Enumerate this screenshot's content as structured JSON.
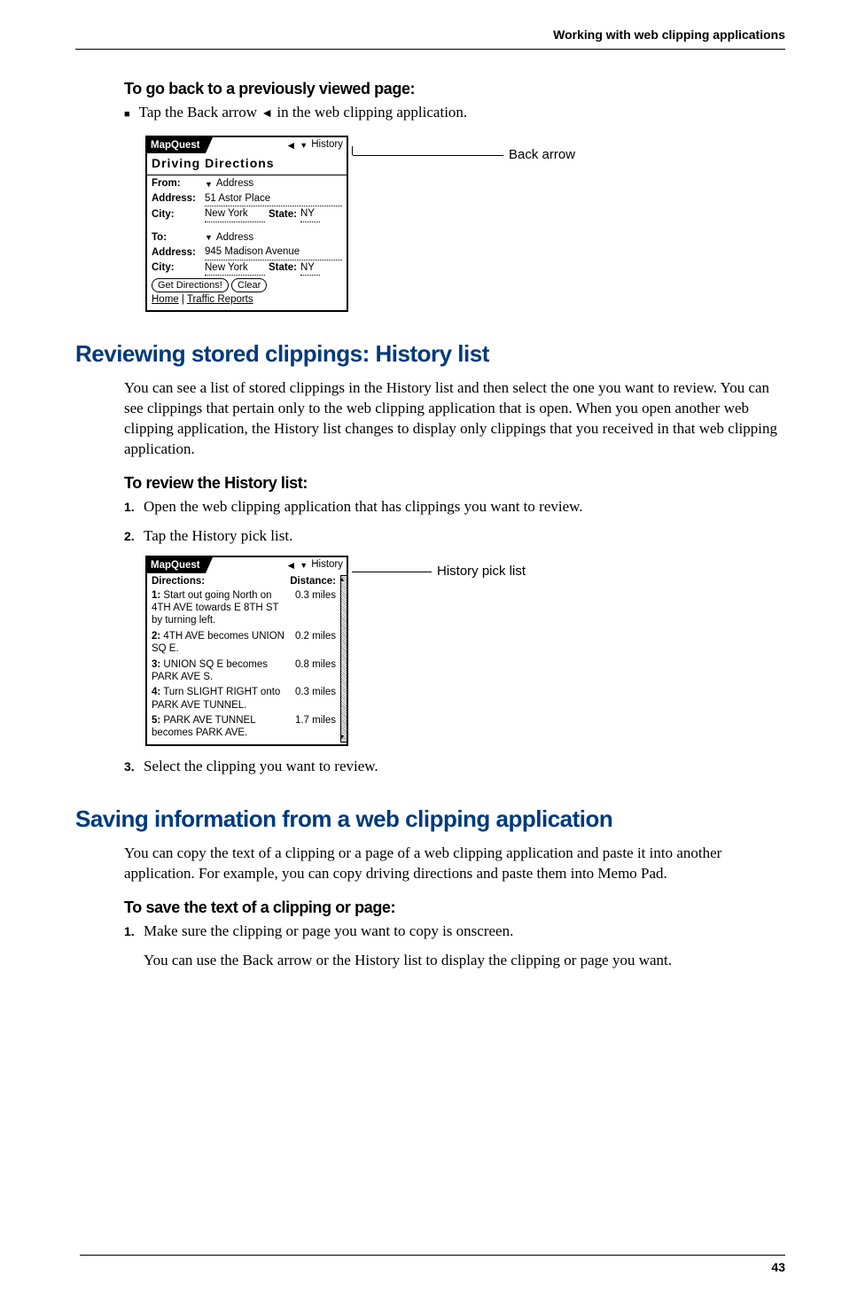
{
  "header": {
    "running": "Working with web clipping applications"
  },
  "section1": {
    "title": "To go back to a previously viewed page:",
    "bullet_text_a": "Tap the Back arrow ",
    "bullet_text_b": " in the web clipping application."
  },
  "fig1": {
    "callout": "Back arrow",
    "app_name": "MapQuest",
    "history_label": "History",
    "page_title": "Driving  Directions",
    "from_label": "From:",
    "to_label": "To:",
    "dropdown_address": "Address",
    "address_label": "Address:",
    "city_label": "City:",
    "state_label": "State:",
    "from_address": "51 Astor Place",
    "from_city": "New York",
    "from_state": "NY",
    "to_address": "945 Madison Avenue",
    "to_city": "New York",
    "to_state": "NY",
    "btn_get": "Get Directions!",
    "btn_clear": "Clear",
    "link_home": "Home",
    "link_traffic": "Traffic Reports"
  },
  "section2": {
    "heading": "Reviewing stored clippings: History list",
    "para": "You can see a list of stored clippings in the History list and then select the one you want to review. You can see clippings that pertain only to the web clipping application that is open. When you open another web clipping application, the History list changes to display only clippings that you received in that web clipping application.",
    "subheading": "To review the History list:",
    "step1": "Open the web clipping application that has clippings you want to review.",
    "step2": "Tap the History pick list.",
    "step3": "Select the clipping you want to review."
  },
  "fig2": {
    "callout": "History pick list",
    "app_name": "MapQuest",
    "history_label": "History",
    "col_directions": "Directions:",
    "col_distance": "Distance:",
    "rows": [
      {
        "n": "1:",
        "text": "Start out going North on 4TH AVE towards E 8TH ST by turning left.",
        "dist": "0.3 miles"
      },
      {
        "n": "2:",
        "text": "4TH AVE becomes UNION SQ E.",
        "dist": "0.2 miles"
      },
      {
        "n": "3:",
        "text": "UNION SQ E becomes PARK AVE S.",
        "dist": "0.8 miles"
      },
      {
        "n": "4:",
        "text": "Turn SLIGHT RIGHT onto PARK AVE TUNNEL.",
        "dist": "0.3 miles"
      },
      {
        "n": "5:",
        "text": "PARK AVE TUNNEL becomes PARK AVE.",
        "dist": "1.7 miles"
      }
    ]
  },
  "section3": {
    "heading": "Saving information from a web clipping application",
    "para": "You can copy the text of a clipping or a page of a web clipping application and paste it into another application. For example, you can copy driving directions and paste them into Memo Pad.",
    "subheading": "To save the text of a clipping or page:",
    "step1": "Make sure the clipping or page you want to copy is onscreen.",
    "step1_sub": "You can use the Back arrow or the History list to display the clipping or page you want."
  },
  "footer": {
    "page_number": "43"
  }
}
